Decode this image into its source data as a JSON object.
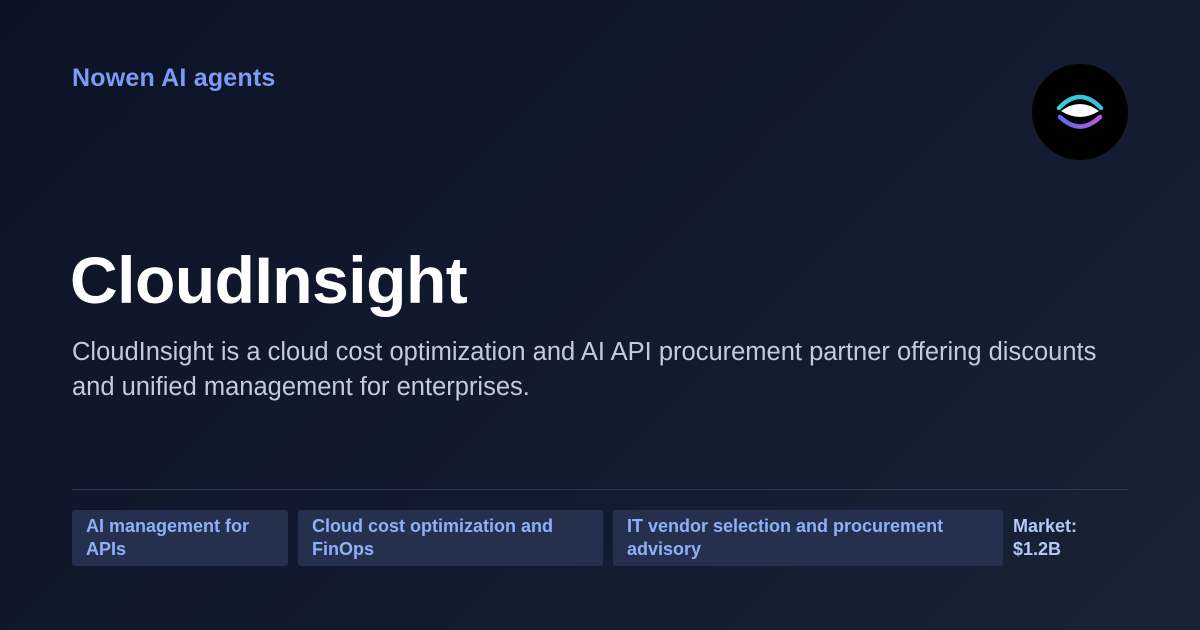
{
  "header": {
    "brand": "Nowen AI agents",
    "logo_icon": "eye-logo-icon"
  },
  "main": {
    "title": "CloudInsight",
    "description": "CloudInsight is a cloud cost optimization and AI API procurement partner offering discounts and unified management for enterprises."
  },
  "tags": [
    "AI management for APIs",
    "Cloud cost optimization and FinOps",
    "IT vendor selection and procurement advisory"
  ],
  "market": {
    "label": "Market:",
    "value": "$1.2B"
  },
  "colors": {
    "background": "#111930",
    "brand_accent": "#7b9cf4",
    "tag_background": "#24304d",
    "logo_teal": "#2fd4d0",
    "logo_purple": "#9b54d8"
  }
}
